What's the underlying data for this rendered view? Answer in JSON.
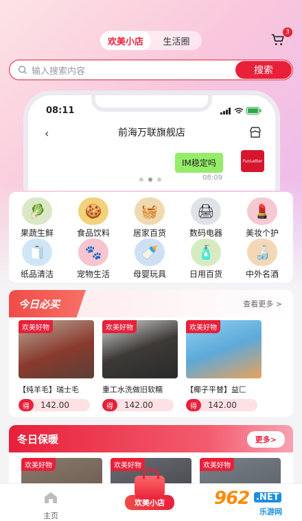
{
  "header": {
    "tabs": [
      {
        "label": "欢美小店",
        "active": true
      },
      {
        "label": "生活圈",
        "active": false
      }
    ],
    "cart_icon": "cart-icon",
    "cart_count": "3"
  },
  "search": {
    "placeholder": "输入搜索内容",
    "button_label": "搜索"
  },
  "banner": {
    "time": "08:11",
    "store_title": "前海万联旗舰店",
    "message": "IM稳定吗",
    "message_time": "08:09",
    "dots": 3,
    "active_dot": 1
  },
  "categories": [
    {
      "label": "果蔬生鲜",
      "color": "#dbe8c8"
    },
    {
      "label": "食品饮料",
      "color": "#f2d27a"
    },
    {
      "label": "居家百货",
      "color": "#f0d9b0"
    },
    {
      "label": "数码电器",
      "color": "#dfe3e8"
    },
    {
      "label": "美妆个护",
      "color": "#f6c9d2"
    },
    {
      "label": "纸品清洁",
      "color": "#cfe6f7"
    },
    {
      "label": "宠物生活",
      "color": "#f7c4cf"
    },
    {
      "label": "母婴玩具",
      "color": "#cfe0f5"
    },
    {
      "label": "日用百货",
      "color": "#d6ecc0"
    },
    {
      "label": "中外名酒",
      "color": "#f3d7b6"
    }
  ],
  "today": {
    "title": "今日必买",
    "more": "查看更多 >",
    "products": [
      {
        "tag": "欢美好物",
        "name": "【纯羊毛】瑞士毛",
        "price_prefix": "得",
        "price": "142.00",
        "color": "#8a3a2e"
      },
      {
        "tag": "欢美好物",
        "name": "重工水洗做旧软糯",
        "price_prefix": "得",
        "price": "142.00",
        "color": "#3d3a36"
      },
      {
        "tag": "欢美好物",
        "name": "【椰子平替】益匚",
        "price_prefix": "得",
        "price": "142.00",
        "color": "#5ea9d9"
      }
    ]
  },
  "warm": {
    "title": "冬日保暖",
    "more": "更多>",
    "products": [
      {
        "tag": "欢美好物",
        "color": "#6b5a4e"
      },
      {
        "tag": "欢美好物",
        "color": "#44464c"
      },
      {
        "tag": "欢美好物",
        "color": "#5a6068"
      }
    ]
  },
  "tabbar": {
    "home_label": "主页",
    "center_label": "欢美小店"
  },
  "watermark": {
    "num": "962",
    "net": ".NET",
    "sub": "乐游网"
  }
}
